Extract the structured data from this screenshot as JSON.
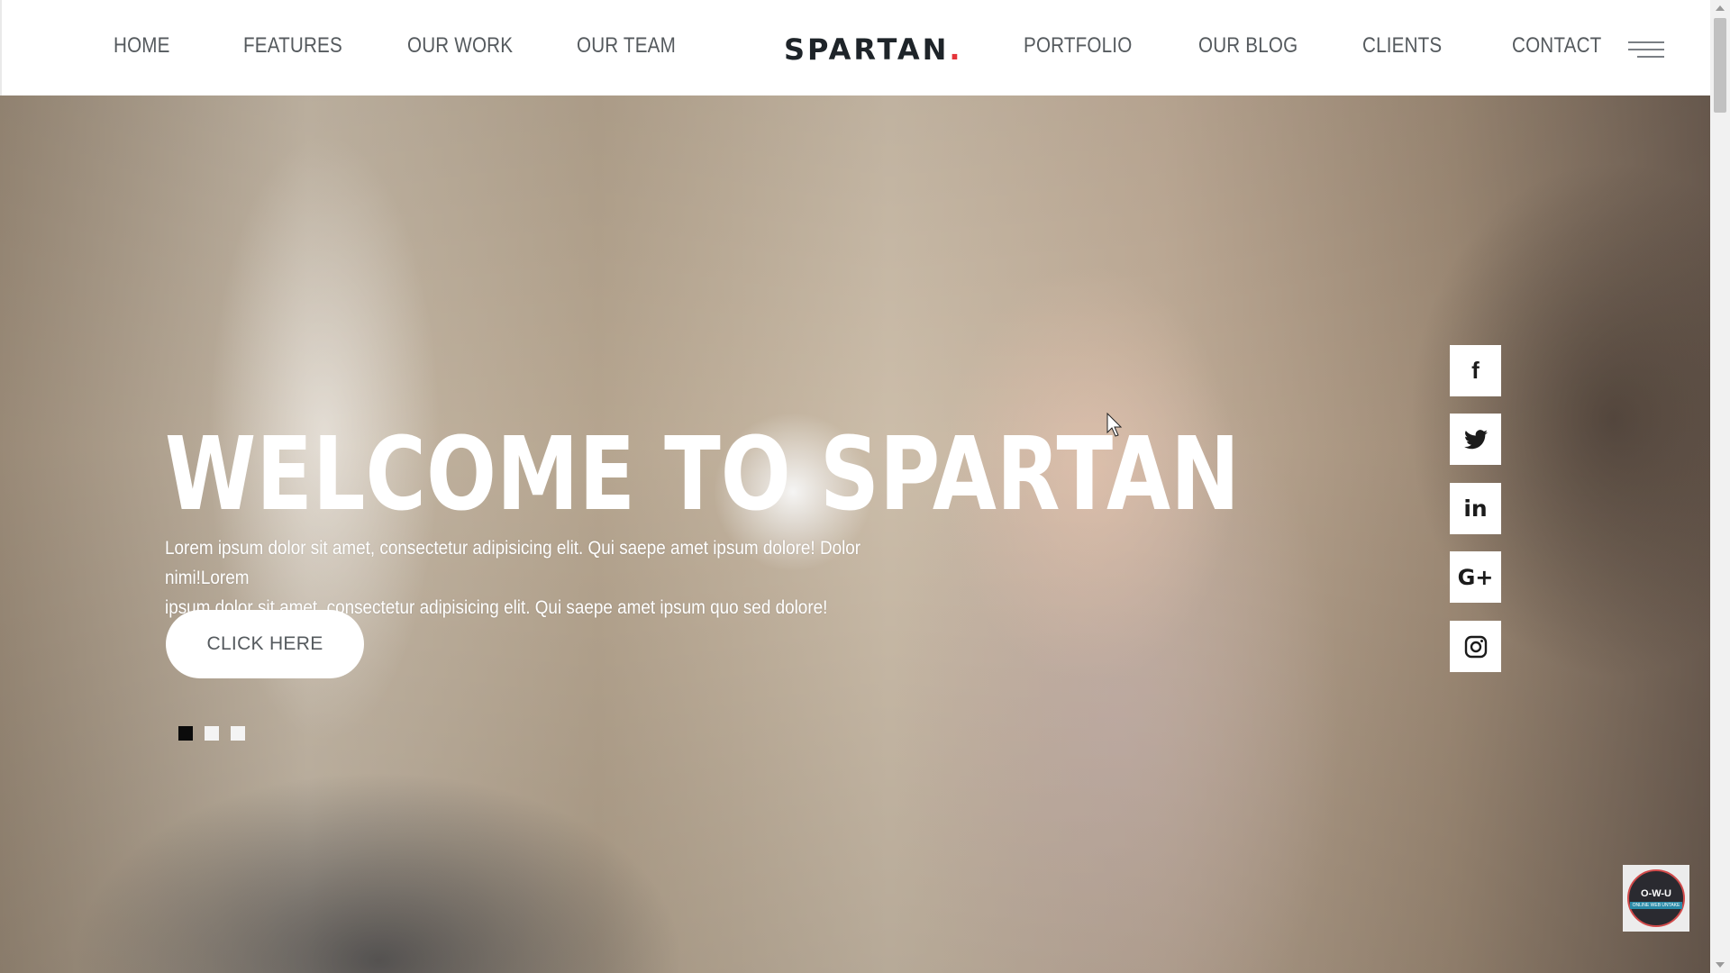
{
  "nav": {
    "left": [
      "HOME",
      "FEATURES",
      "OUR WORK",
      "OUR TEAM"
    ],
    "right": [
      "PORTFOLIO",
      "OUR BLOG",
      "CLIENTS",
      "CONTACT"
    ],
    "menu_icon": "hamburger-menu-icon"
  },
  "logo": {
    "text": "SPARTAN",
    "dot": ".",
    "accent_color": "#e5343a"
  },
  "hero": {
    "title": "WELCOME TO SPARTAN",
    "text_line1": "Lorem ipsum dolor sit amet, consectetur adipisicing elit. Qui saepe amet ipsum dolore! Dolor nimi!Lorem",
    "text_line2": "ipsum dolor sit amet, consectetur adipisicing elit. Qui saepe amet ipsum quo sed dolore!",
    "cta_label": "CLICK HERE",
    "slides": {
      "count": 3,
      "active": 1
    }
  },
  "social": [
    "facebook-icon",
    "twitter-icon",
    "linkedin-icon",
    "google-plus-icon",
    "instagram-icon"
  ],
  "badge": {
    "top": "O-W-U",
    "strip": "ONLINE WEB UNTAKE"
  }
}
